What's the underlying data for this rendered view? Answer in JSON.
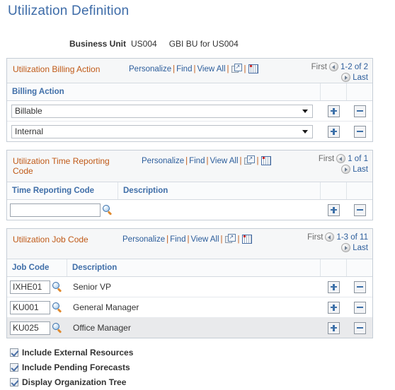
{
  "page": {
    "title": "Utilization Definition"
  },
  "business_unit": {
    "label": "Business Unit",
    "value": "US004",
    "description": "GBI BU for US004"
  },
  "grid_actions": {
    "personalize": "Personalize",
    "find": "Find",
    "view_all": "View All",
    "separator": "|",
    "expand_icon": "expand-window-icon",
    "grid_download_icon": "download-to-spreadsheet-icon"
  },
  "pager_labels": {
    "first": "First",
    "last": "Last",
    "prev_icon": "previous-arrow-icon",
    "next_icon": "next-arrow-icon"
  },
  "row_buttons": {
    "add": "+",
    "delete": "-",
    "lookup_icon": "magnifier-lookup-icon"
  },
  "colors": {
    "title_blue": "#3e6ca8",
    "grid_title_orange": "#c05a18",
    "column_header_blue": "#3f6ea8",
    "link_blue": "#2c5d9b",
    "panel_border": "#c5cdd6",
    "alt_row": "#e9eaec"
  },
  "grids": [
    {
      "id": "utilization-billing-action",
      "title": "Utilization Billing Action",
      "range": "1-2 of 2",
      "columns": [
        "Billing Action"
      ],
      "rows": [
        {
          "billing_action": "Billable",
          "alt": false
        },
        {
          "billing_action": "Internal",
          "alt": false
        }
      ]
    },
    {
      "id": "utilization-time-reporting-code",
      "title": "Utilization Time Reporting Code",
      "range": "1 of 1",
      "columns": [
        "Time Reporting Code",
        "Description"
      ],
      "rows": [
        {
          "code": "",
          "description": "",
          "alt": false
        }
      ]
    },
    {
      "id": "utilization-job-code",
      "title": "Utilization Job Code",
      "range": "1-3 of 11",
      "columns": [
        "Job Code",
        "Description"
      ],
      "rows": [
        {
          "code": "IXHE01",
          "description": "Senior VP",
          "alt": false
        },
        {
          "code": "KU001",
          "description": "General Manager",
          "alt": false
        },
        {
          "code": "KU025",
          "description": "Office Manager",
          "alt": true
        }
      ]
    }
  ],
  "checkboxes": [
    {
      "label": "Include External Resources",
      "checked": true
    },
    {
      "label": "Include Pending Forecasts",
      "checked": true
    },
    {
      "label": "Display Organization Tree",
      "checked": true
    }
  ]
}
